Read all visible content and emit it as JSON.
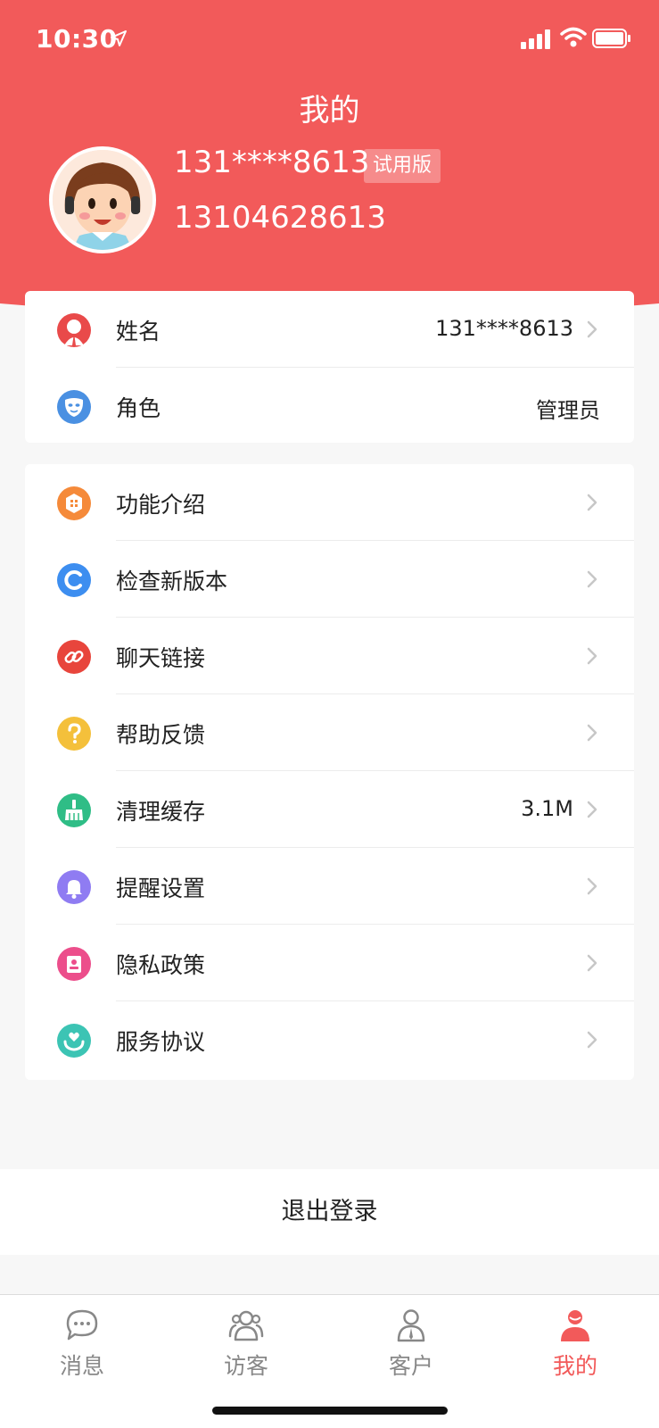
{
  "status_bar": {
    "time": "10:30",
    "icons": [
      "location-arrow-icon",
      "cellular-signal-icon",
      "wifi-icon",
      "battery-icon"
    ]
  },
  "header": {
    "title": "我的",
    "profile": {
      "name": "131****8613",
      "badge": "试用版",
      "phone": "13104628613"
    }
  },
  "info_card": {
    "items": [
      {
        "label": "姓名",
        "value": "131****8613",
        "icon": "user-icon",
        "color": "#e94a4a"
      },
      {
        "label": "角色",
        "value": "管理员",
        "icon": "mask-icon",
        "color": "#4a90e2"
      }
    ]
  },
  "menu_card": {
    "items": [
      {
        "label": "功能介绍",
        "value": "",
        "icon": "features-icon",
        "color": "#f58a3a"
      },
      {
        "label": "检查新版本",
        "value": "",
        "icon": "update-icon",
        "color": "#3d8ef0"
      },
      {
        "label": "聊天链接",
        "value": "",
        "icon": "link-icon",
        "color": "#e8453c"
      },
      {
        "label": "帮助反馈",
        "value": "",
        "icon": "help-icon",
        "color": "#f4c03b"
      },
      {
        "label": "清理缓存",
        "value": "3.1M",
        "icon": "broom-icon",
        "color": "#2fbd86"
      },
      {
        "label": "提醒设置",
        "value": "",
        "icon": "bell-icon",
        "color": "#8f7cf2"
      },
      {
        "label": "隐私政策",
        "value": "",
        "icon": "privacy-icon",
        "color": "#ec4e8b"
      },
      {
        "label": "服务协议",
        "value": "",
        "icon": "heart-hands-icon",
        "color": "#3cc4b4"
      }
    ]
  },
  "logout": {
    "label": "退出登录"
  },
  "tabbar": {
    "tabs": [
      {
        "label": "消息",
        "icon": "chat-bubble-icon",
        "active": false
      },
      {
        "label": "访客",
        "icon": "visitors-icon",
        "active": false
      },
      {
        "label": "客户",
        "icon": "customer-icon",
        "active": false
      },
      {
        "label": "我的",
        "icon": "me-icon",
        "active": true
      }
    ]
  },
  "colors": {
    "accent": "#f25a5a",
    "background": "#f7f7f7"
  }
}
